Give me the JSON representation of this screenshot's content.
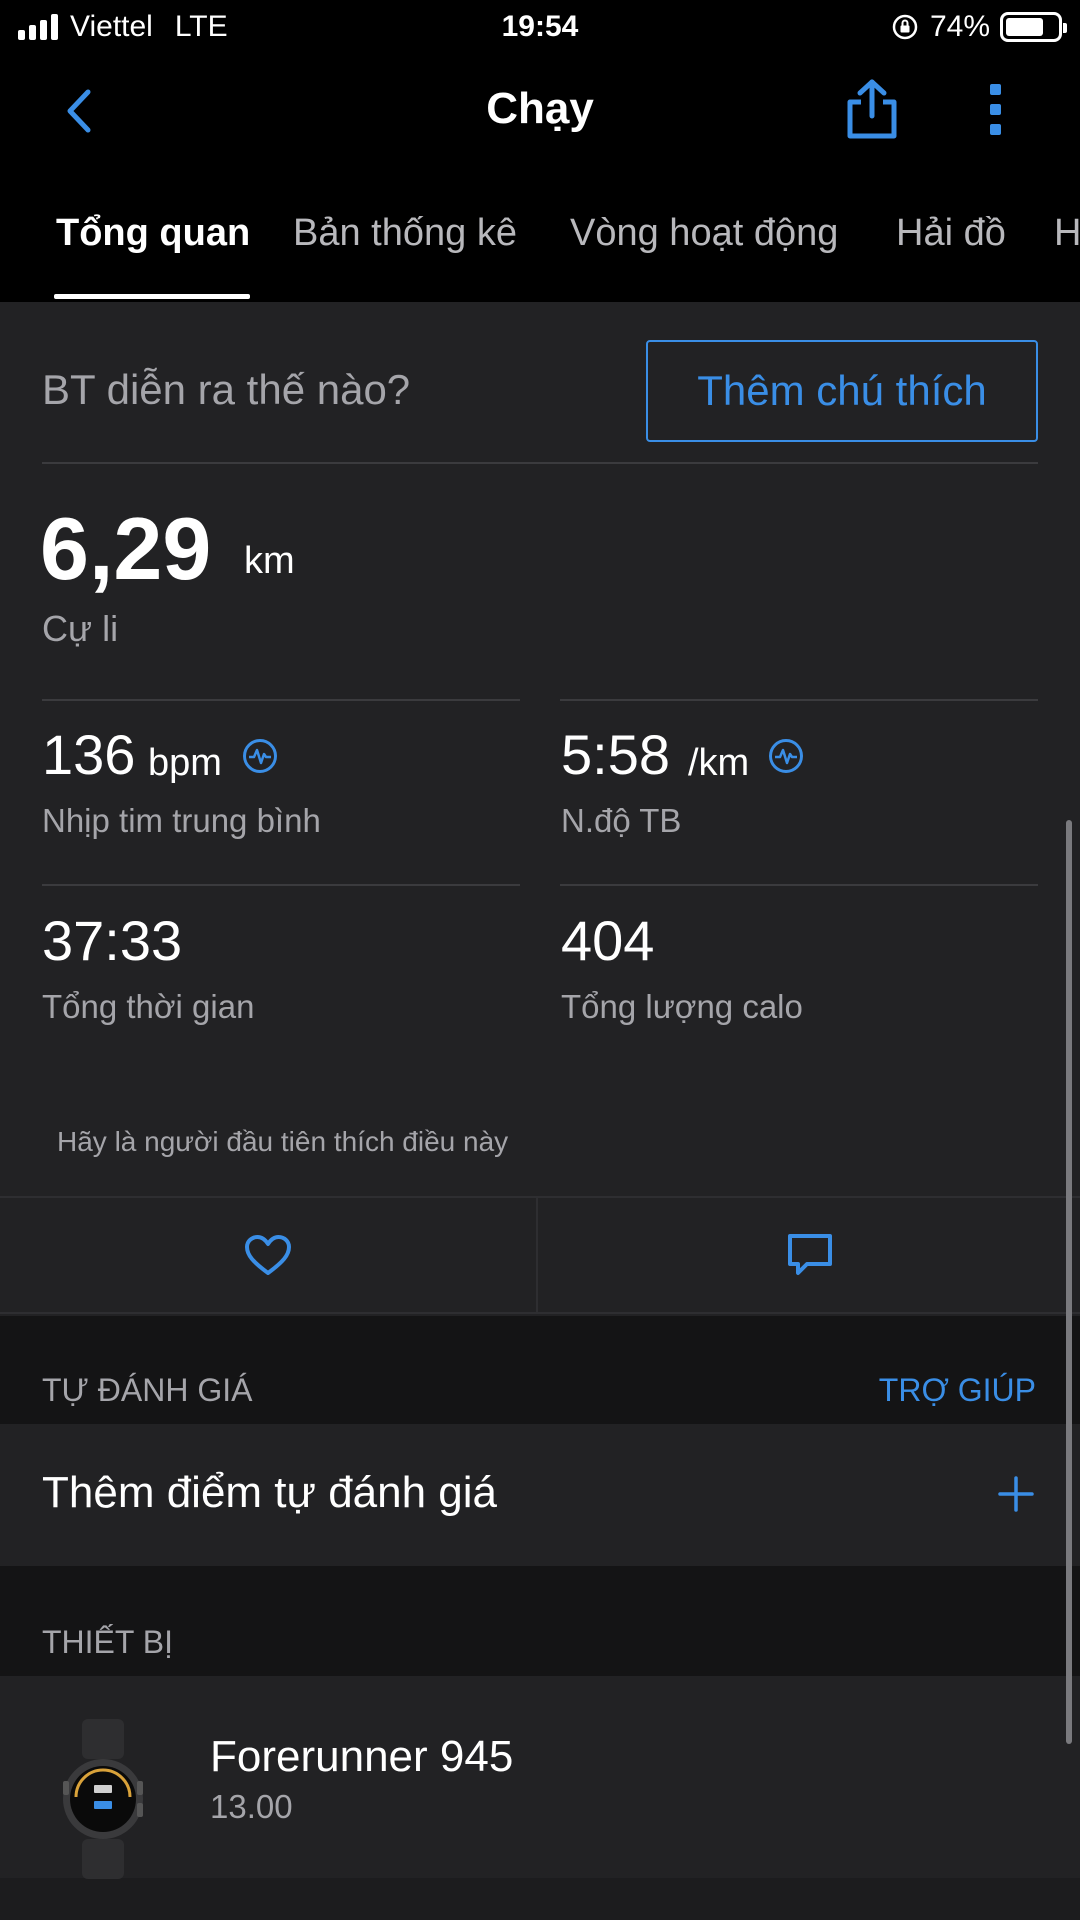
{
  "status_bar": {
    "carrier": "Viettel",
    "network": "LTE",
    "time": "19:54",
    "battery": "74%",
    "battery_level": 0.74
  },
  "nav": {
    "title": "Chạy",
    "back_icon": "chevron-left-icon",
    "share_icon": "share-icon",
    "more_icon": "more-vertical-icon"
  },
  "tabs": [
    {
      "label": "Tổng quan",
      "active": true
    },
    {
      "label": "Bản thống kê"
    },
    {
      "label": "Vòng hoạt động"
    },
    {
      "label": "Hải đồ"
    },
    {
      "label": "H"
    }
  ],
  "overview": {
    "question": "BT diễn ra thế nào?",
    "add_note_label": "Thêm chú thích",
    "distance_value": "6,29",
    "distance_unit": "km",
    "distance_label": "Cự li",
    "stats": [
      {
        "value": "136",
        "unit": "bpm",
        "label": "Nhịp tim trung bình"
      },
      {
        "value": "5:58",
        "unit": "/km",
        "label": "N.độ TB"
      },
      {
        "value": "37:33",
        "label": "Tổng thời gian"
      },
      {
        "value": "404",
        "label": "Tổng lượng calo"
      }
    ],
    "likes_text": "Hãy là người đầu tiên thích điều này"
  },
  "self_eval": {
    "section_title": "TỰ ĐÁNH GIÁ",
    "help_label": "TRỢ GIÚP",
    "add_label": "Thêm điểm tự đánh giá"
  },
  "device": {
    "section_title": "THIẾT BỊ",
    "name": "Forerunner 945",
    "version": "13.00"
  },
  "colors": {
    "accent": "#3a8ee6",
    "background": "#222224",
    "bar": "#000000"
  }
}
